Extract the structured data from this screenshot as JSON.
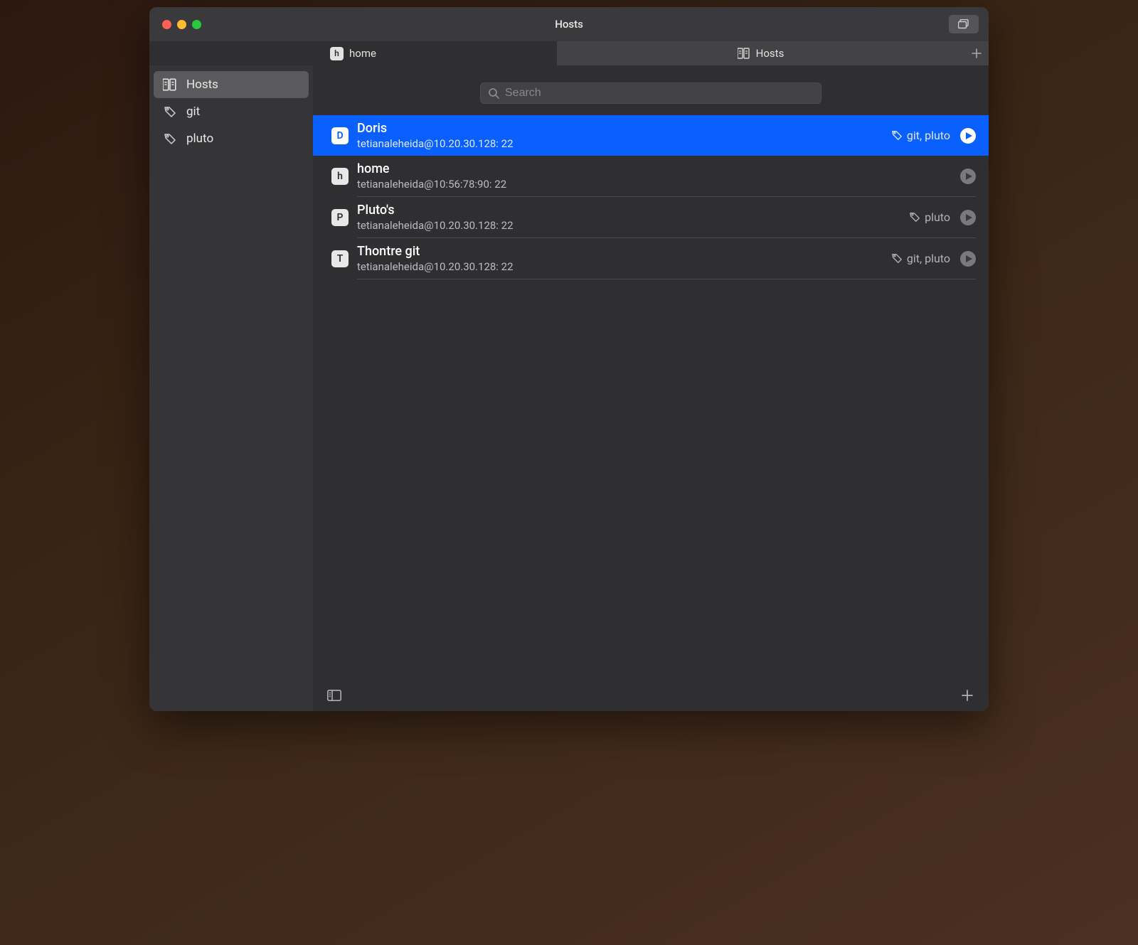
{
  "window": {
    "title": "Hosts"
  },
  "tabs": [
    {
      "label": "home",
      "icon_letter": "h",
      "active": true
    },
    {
      "label": "Hosts",
      "kind": "hosts",
      "active": false
    }
  ],
  "sidebar": {
    "items": [
      {
        "label": "Hosts",
        "kind": "hosts",
        "selected": true
      },
      {
        "label": "git",
        "kind": "tag"
      },
      {
        "label": "pluto",
        "kind": "tag"
      }
    ]
  },
  "search": {
    "placeholder": "Search",
    "value": ""
  },
  "hosts": [
    {
      "avatar": "D",
      "name": "Doris",
      "address": "tetianaleheida@10.20.30.128: 22",
      "tags": "git, pluto",
      "selected": true
    },
    {
      "avatar": "h",
      "name": "home",
      "address": "tetianaleheida@10:56:78:90: 22",
      "tags": "",
      "selected": false
    },
    {
      "avatar": "P",
      "name": "Pluto's",
      "address": "tetianaleheida@10.20.30.128: 22",
      "tags": "pluto",
      "selected": false
    },
    {
      "avatar": "T",
      "name": "Thontre git",
      "address": "tetianaleheida@10.20.30.128: 22",
      "tags": "git, pluto",
      "selected": false
    }
  ]
}
